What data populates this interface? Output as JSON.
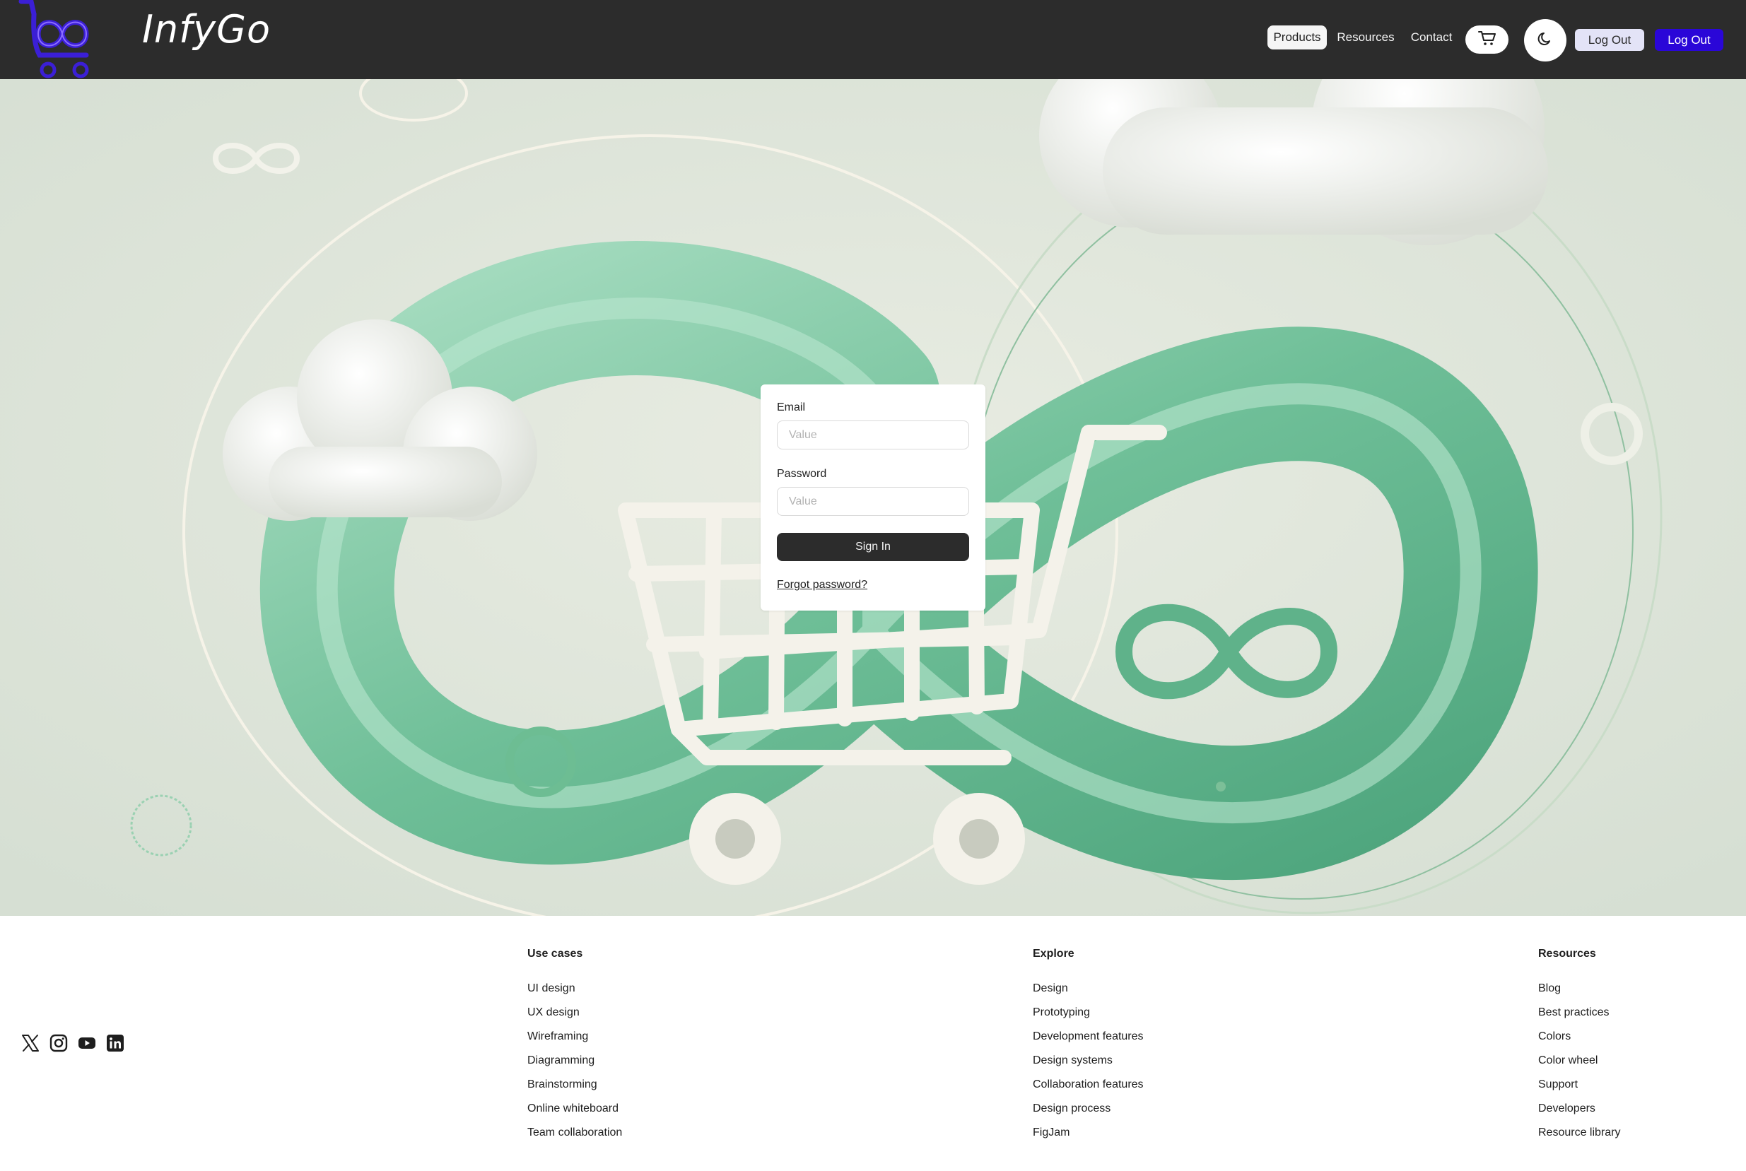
{
  "header": {
    "brand": "InfyGo",
    "nav": [
      "Products",
      "Resources",
      "Contact"
    ],
    "active_nav": "Products",
    "logout_light_label": "Log Out",
    "logout_dark_label": "Log Out",
    "icons": [
      "logo-cart-infinity-icon",
      "shopping-cart-icon",
      "moon-icon"
    ]
  },
  "login": {
    "email_label": "Email",
    "email_placeholder": "Value",
    "password_label": "Password",
    "password_placeholder": "Value",
    "signin_label": "Sign In",
    "forgot_label": "Forgot password?"
  },
  "footer": {
    "social": [
      "x-icon",
      "instagram-icon",
      "youtube-icon",
      "linkedin-icon"
    ],
    "columns": [
      {
        "title": "Use cases",
        "items": [
          "UI design",
          "UX design",
          "Wireframing",
          "Diagramming",
          "Brainstorming",
          "Online whiteboard",
          "Team collaboration"
        ]
      },
      {
        "title": "Explore",
        "items": [
          "Design",
          "Prototyping",
          "Development features",
          "Design systems",
          "Collaboration features",
          "Design process",
          "FigJam"
        ]
      },
      {
        "title": "Resources",
        "items": [
          "Blog",
          "Best practices",
          "Colors",
          "Color wheel",
          "Support",
          "Developers",
          "Resource library"
        ]
      }
    ]
  },
  "colors": {
    "header_bg": "#2c2c2c",
    "accent": "#2a06d8",
    "hero_green": "#7fc8a4",
    "hero_bg": "#dfe5db"
  }
}
